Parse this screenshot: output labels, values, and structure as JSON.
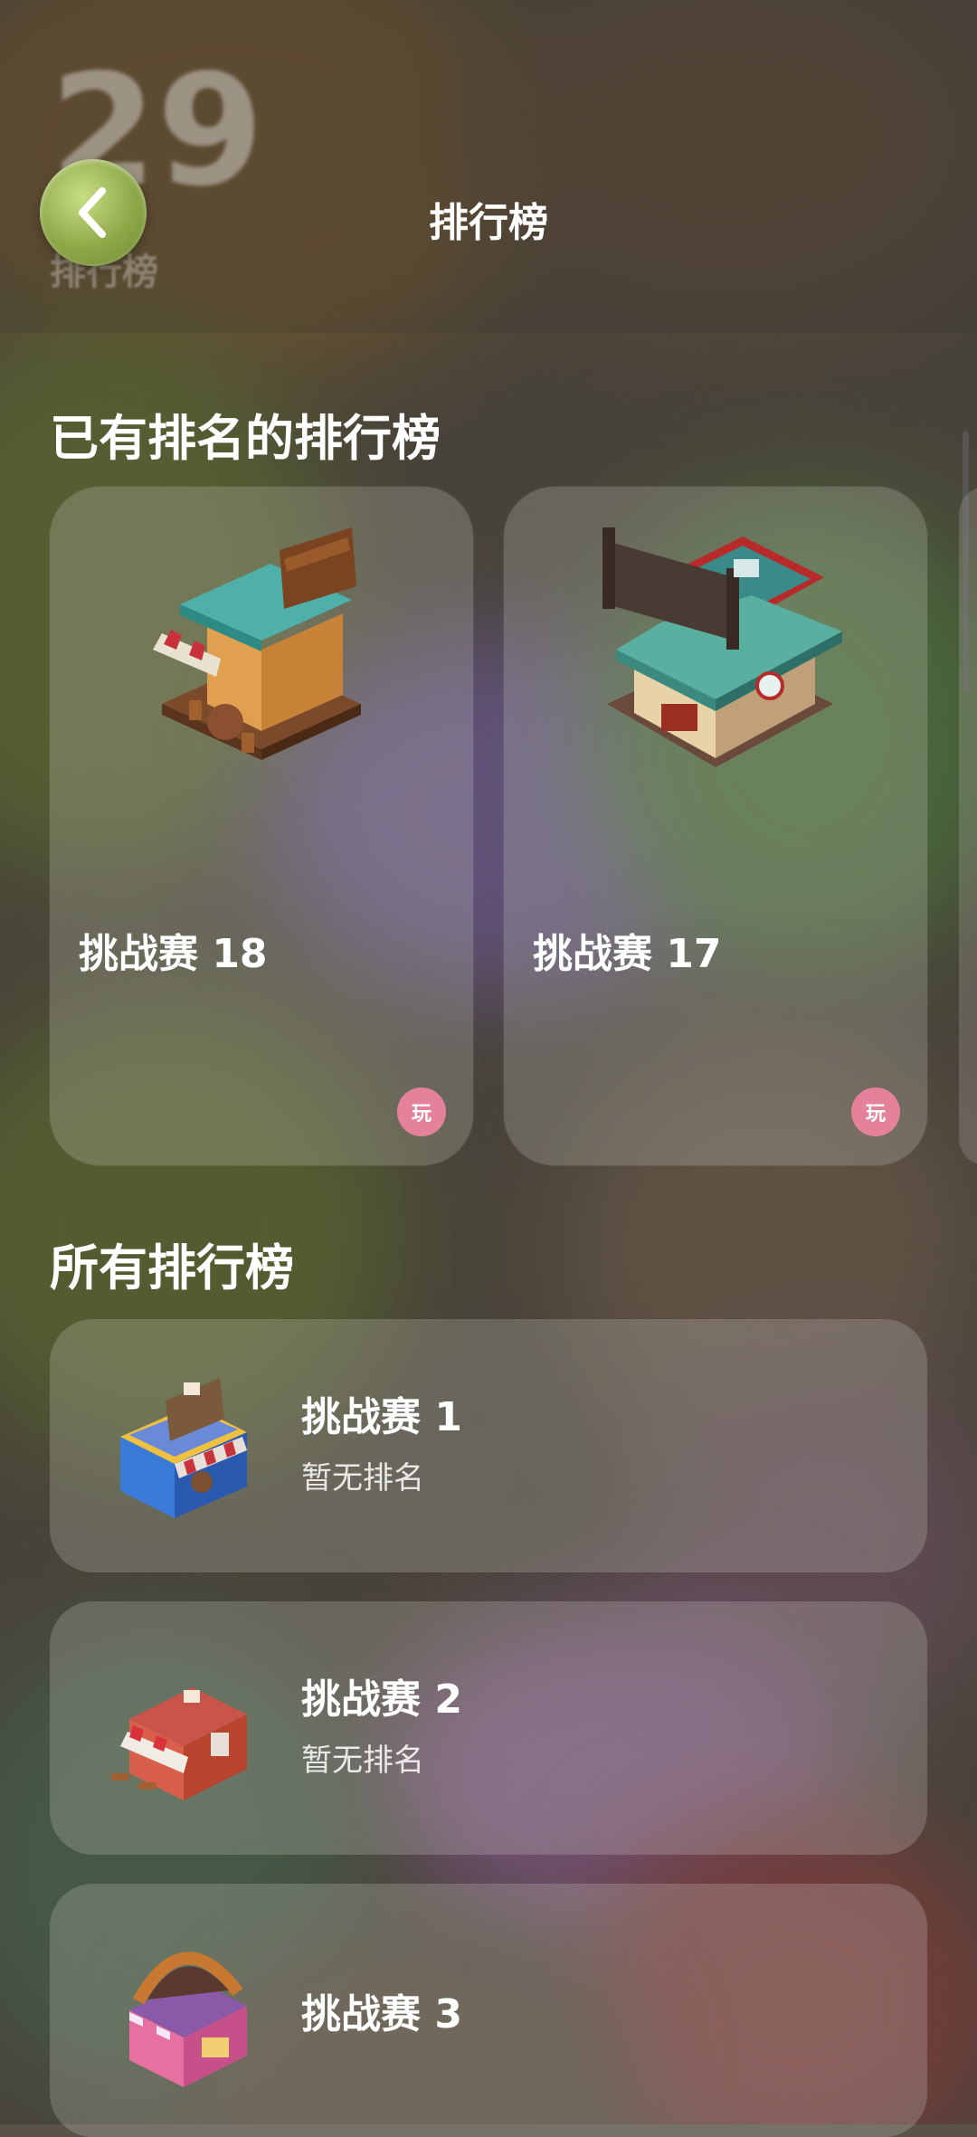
{
  "header": {
    "ghost_number": "29",
    "ghost_label": "排行榜",
    "title": "排行榜",
    "back_icon": "chevron-left-icon"
  },
  "ranked_section": {
    "title": "已有排名的排行榜",
    "cards": [
      {
        "name": "挑战赛 18",
        "badge": "玩"
      },
      {
        "name": "挑战赛 17",
        "badge": "玩"
      }
    ]
  },
  "all_section": {
    "title": "所有排行榜",
    "rows": [
      {
        "name": "挑战赛 1",
        "status": "暂无排名"
      },
      {
        "name": "挑战赛 2",
        "status": "暂无排名"
      },
      {
        "name": "挑战赛 3",
        "status": ""
      }
    ]
  },
  "colors": {
    "badge": "#e4829c",
    "back_button": "#8ea848"
  }
}
